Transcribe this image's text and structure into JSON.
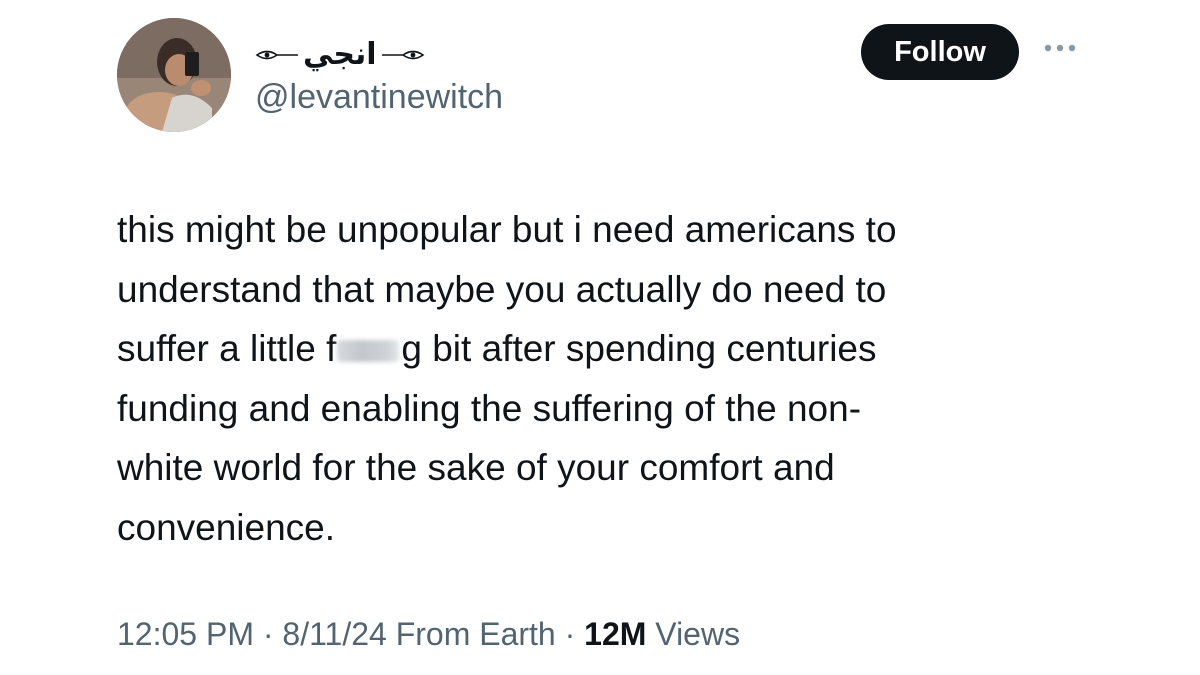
{
  "author": {
    "display_name": "انجي",
    "handle": "@levantinewitch",
    "avatar_icon": "profile-photo-avatar"
  },
  "actions": {
    "follow_label": "Follow",
    "more_icon": "more-options-icon"
  },
  "tweet": {
    "lines": [
      "this might be unpopular but i need americans to",
      "understand that maybe you actually do need to",
      "bit after spending centuries",
      "funding and enabling the suffering of the non-",
      "white world for the sake of your comfort and",
      "convenience."
    ],
    "censored_prefix": "suffer a little f",
    "censored_suffix": "g"
  },
  "meta": {
    "time": "12:05 PM",
    "separator": "·",
    "date": "8/11/24",
    "source": "From Earth",
    "views_count": "12M",
    "views_label": "Views"
  },
  "colors": {
    "text_primary": "#0f1419",
    "text_secondary": "#536471",
    "follow_bg": "#0f1419",
    "follow_text": "#ffffff"
  }
}
